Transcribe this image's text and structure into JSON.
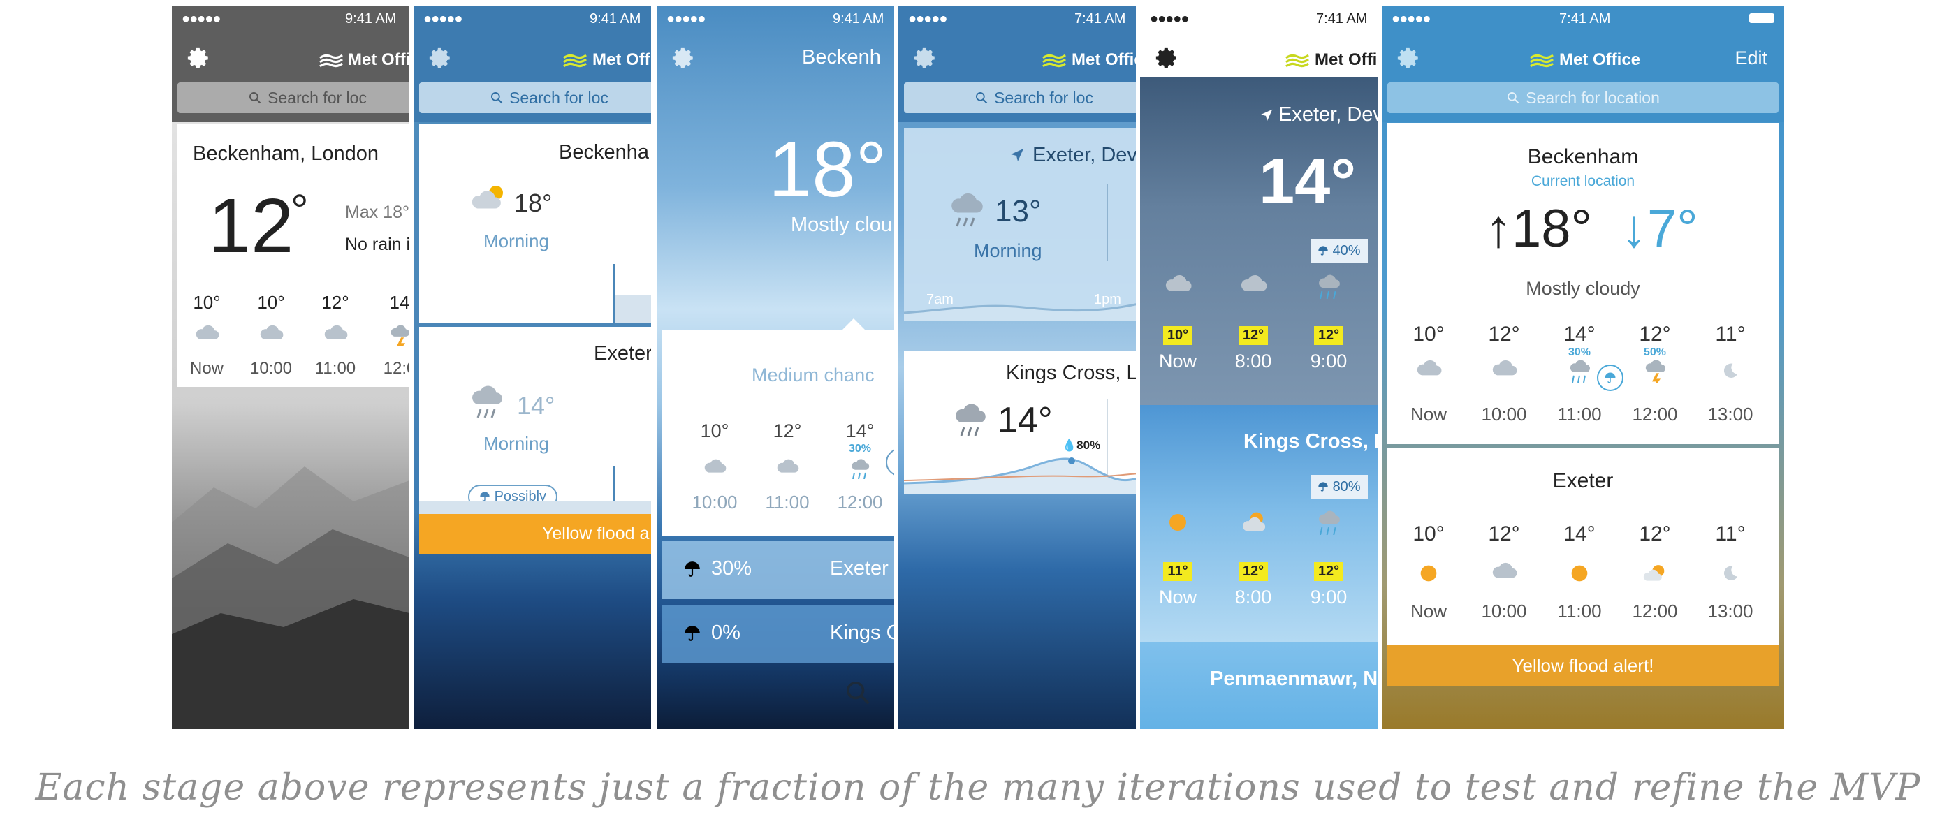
{
  "status": {
    "dots": "●●●●●",
    "time_a": "9:41 AM",
    "time_b": "7:41 AM"
  },
  "brand": {
    "name": "Met Office"
  },
  "search": {
    "placeholder_cut": "Search for loc",
    "placeholder_full": "Search for location"
  },
  "icons": {
    "gear": "gear-icon",
    "logo": "met-office-logo-icon",
    "search": "search-icon",
    "umbrella": "umbrella-icon",
    "location": "location-arrow-icon",
    "cloud": "cloud-icon",
    "sun": "sun-icon",
    "rain": "rain-icon",
    "moon": "moon-icon"
  },
  "colors": {
    "accent_yellow": "#f5a623",
    "flood_orange": "#e8a12a",
    "temp_blue": "#4aa8d8",
    "highlight_yellow": "#f3ea1f"
  },
  "p1": {
    "location": "Beckenham, London",
    "temp": "12",
    "deg": "°",
    "max": "Max 18°",
    "rain": "No rain i",
    "hours": [
      {
        "t": "10°",
        "l": "Now"
      },
      {
        "t": "10°",
        "l": "10:00"
      },
      {
        "t": "12°",
        "l": "11:00"
      },
      {
        "t": "14",
        "l": "12:0"
      }
    ]
  },
  "p2": {
    "card1_title": "Beckenha",
    "card1_temp": "18°",
    "card1_period": "Morning",
    "card2_title": "Exeter",
    "card2_temp": "14°",
    "card2_period": "Morning",
    "pill": "Possibly",
    "alert": "Yellow flood a"
  },
  "p3": {
    "header": "Beckenh",
    "temp": "18° S",
    "summary": "Mostly clou",
    "card_title": "Medium chanc",
    "hours": [
      {
        "t": "10°",
        "l": "10:00",
        "p": ""
      },
      {
        "t": "12°",
        "l": "11:00",
        "p": ""
      },
      {
        "t": "14°",
        "l": "12:00",
        "p": "30%"
      }
    ],
    "row1_pct": "30%",
    "row1_loc": "Exeter",
    "row2_pct": "0%",
    "row2_loc": "Kings Cro"
  },
  "p4": {
    "location": "Exeter, Dev",
    "temp": "13°",
    "period": "Morning",
    "axis_a": "7am",
    "axis_b": "1pm",
    "card2_title": "Kings Cross, L",
    "card2_temp": "14°",
    "card2_pct": "80%"
  },
  "p5": {
    "location": "Exeter, Dev",
    "temp": "14° ",
    "badge1": "40%",
    "hours1": [
      {
        "t": "10°",
        "l": "Now"
      },
      {
        "t": "12°",
        "l": "8:00"
      },
      {
        "t": "12°",
        "l": "9:00"
      }
    ],
    "section2": "Kings Cross, L",
    "badge2": "80%",
    "hours2": [
      {
        "t": "11°",
        "l": "Now"
      },
      {
        "t": "12°",
        "l": "8:00"
      },
      {
        "t": "12°",
        "l": "9:00"
      }
    ],
    "section3": "Penmaenmawr, N"
  },
  "p6": {
    "edit": "Edit",
    "title": "Beckenham",
    "subtitle": "Current location",
    "high": "18°",
    "low": "7°",
    "summary": "Mostly cloudy",
    "hours": [
      {
        "t": "10°",
        "l": "Now",
        "p": ""
      },
      {
        "t": "12°",
        "l": "10:00",
        "p": ""
      },
      {
        "t": "14°",
        "l": "11:00",
        "p": "30%"
      },
      {
        "t": "12°",
        "l": "12:00",
        "p": "50%"
      },
      {
        "t": "11°",
        "l": "13:00",
        "p": ""
      }
    ],
    "card2_title": "Exeter",
    "hours2": [
      {
        "t": "10°",
        "l": "Now"
      },
      {
        "t": "12°",
        "l": "10:00"
      },
      {
        "t": "14°",
        "l": "11:00"
      },
      {
        "t": "12°",
        "l": "12:00"
      },
      {
        "t": "11°",
        "l": "13:00"
      }
    ],
    "alert": "Yellow flood alert!"
  },
  "caption": "Each stage above represents just a fraction of the many iterations used to test and refine the MVP"
}
